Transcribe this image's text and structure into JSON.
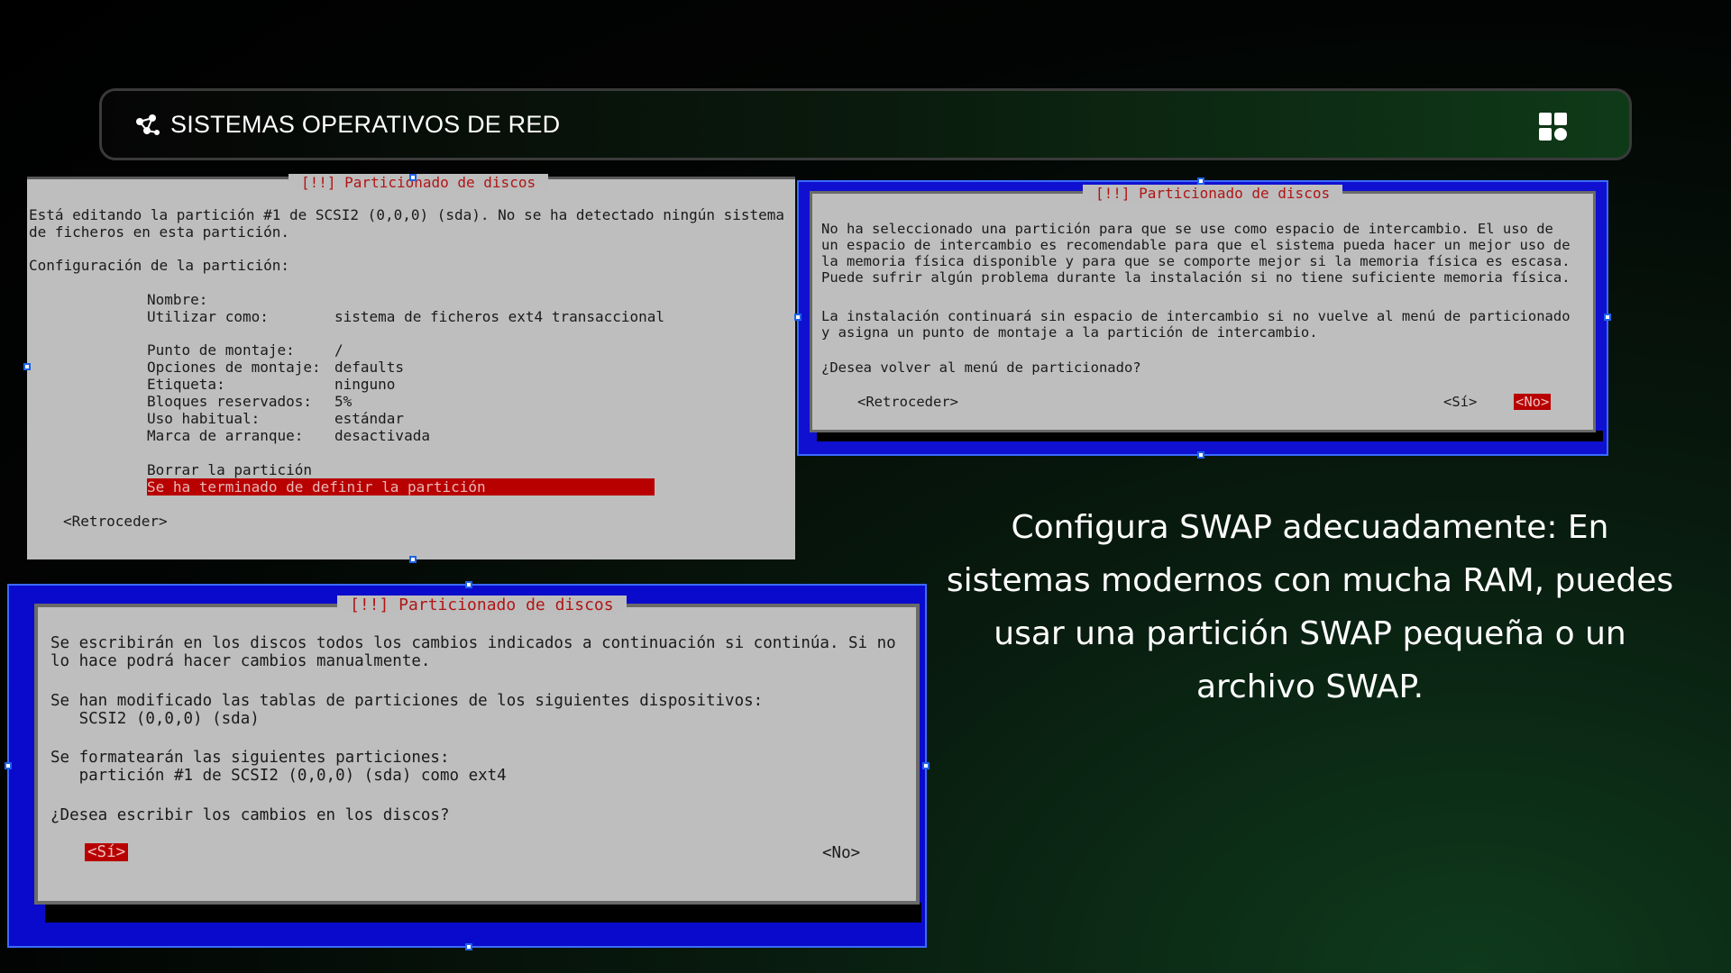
{
  "header": {
    "title": "SISTEMAS OPERATIVOS DE RED"
  },
  "window1": {
    "frame_title": "[!!] Particionado de discos",
    "intro": "Está editando la partición #1 de SCSI2 (0,0,0) (sda). No se ha detectado ningún sistema\nde ficheros en esta partición.",
    "config_label": "Configuración de la partición:",
    "fields": [
      {
        "label": "Nombre:",
        "value": ""
      },
      {
        "label": "Utilizar como:",
        "value": "sistema de ficheros ext4 transaccional"
      },
      {
        "label": "Punto de montaje:",
        "value": "/"
      },
      {
        "label": "Opciones de montaje:",
        "value": "defaults"
      },
      {
        "label": "Etiqueta:",
        "value": "ninguno"
      },
      {
        "label": "Bloques reservados:",
        "value": "5%"
      },
      {
        "label": "Uso habitual:",
        "value": "estándar"
      },
      {
        "label": "Marca de arranque:",
        "value": "desactivada"
      }
    ],
    "delete_option": "Borrar la partición",
    "done_option": "Se ha terminado de definir la partición",
    "back_button": "<Retroceder>"
  },
  "window2": {
    "frame_title": "[!!] Particionado de discos",
    "paragraph1": "No ha seleccionado una partición para que se use como espacio de intercambio. El uso de\nun espacio de intercambio es recomendable para que el sistema pueda hacer un mejor uso de\nla memoria física disponible y para que se comporte mejor si la memoria física es escasa.\nPuede sufrir algún problema durante la instalación si no tiene suficiente memoria física.",
    "paragraph2": "La instalación continuará sin espacio de intercambio si no vuelve al menú de particionado\ny asigna un punto de montaje a la partición de intercambio.",
    "question": "¿Desea volver al menú de particionado?",
    "back_button": "<Retroceder>",
    "yes_button": "<Sí>",
    "no_button": "<No>"
  },
  "window3": {
    "frame_title": "[!!] Particionado de discos",
    "paragraph1": "Se escribirán en los discos todos los cambios indicados a continuación si continúa. Si no\nlo hace podrá hacer cambios manualmente.",
    "paragraph2": "Se han modificado las tablas de particiones de los siguientes dispositivos:\n   SCSI2 (0,0,0) (sda)",
    "paragraph3": "Se formatearán las siguientes particiones:\n   partición #1 de SCSI2 (0,0,0) (sda) como ext4",
    "question": "¿Desea escribir los cambios en los discos?",
    "yes_button": "<Sí>",
    "no_button": "<No>"
  },
  "caption": "Configura SWAP adecuadamente: En sistemas modernos con mucha RAM, puedes usar una partición SWAP pequeña o un archivo SWAP.",
  "colors": {
    "selection_red": "#b80000",
    "title_red": "#b01515",
    "dialog_blue": "#1010d0",
    "dialog_gray": "#bebebe"
  },
  "icons": [
    "network-logo-icon",
    "grid-apps-icon"
  ]
}
